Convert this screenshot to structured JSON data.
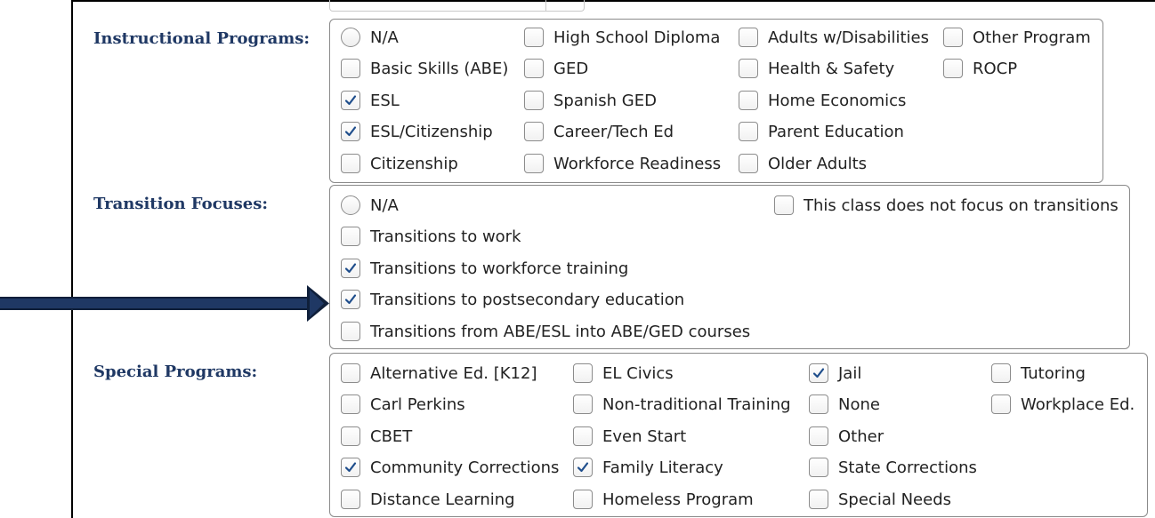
{
  "instructional": {
    "label": "Instructional Programs:",
    "options": [
      {
        "label": "N/A",
        "type": "radio",
        "checked": false
      },
      {
        "label": "High School Diploma",
        "type": "checkbox",
        "checked": false
      },
      {
        "label": "Adults w/Disabilities",
        "type": "checkbox",
        "checked": false
      },
      {
        "label": "Other Program",
        "type": "checkbox",
        "checked": false
      },
      {
        "label": "Basic Skills (ABE)",
        "type": "checkbox",
        "checked": false
      },
      {
        "label": "GED",
        "type": "checkbox",
        "checked": false
      },
      {
        "label": "Health & Safety",
        "type": "checkbox",
        "checked": false
      },
      {
        "label": "ROCP",
        "type": "checkbox",
        "checked": false
      },
      {
        "label": "ESL",
        "type": "checkbox",
        "checked": true
      },
      {
        "label": "Spanish GED",
        "type": "checkbox",
        "checked": false
      },
      {
        "label": "Home Economics",
        "type": "checkbox",
        "checked": false
      },
      {
        "label": "ESL/Citizenship",
        "type": "checkbox",
        "checked": true
      },
      {
        "label": "Career/Tech Ed",
        "type": "checkbox",
        "checked": false
      },
      {
        "label": "Parent Education",
        "type": "checkbox",
        "checked": false
      },
      {
        "label": "Citizenship",
        "type": "checkbox",
        "checked": false
      },
      {
        "label": "Workforce Readiness",
        "type": "checkbox",
        "checked": false
      },
      {
        "label": "Older Adults",
        "type": "checkbox",
        "checked": false
      }
    ]
  },
  "transition": {
    "label": "Transition Focuses:",
    "options": [
      {
        "label": "N/A",
        "type": "radio",
        "checked": false
      },
      {
        "label": "This class does not focus on transitions",
        "type": "checkbox",
        "checked": false
      },
      {
        "label": "Transitions to work",
        "type": "checkbox",
        "checked": false
      },
      {
        "label": "Transitions to workforce training",
        "type": "checkbox",
        "checked": true
      },
      {
        "label": "Transitions to postsecondary education",
        "type": "checkbox",
        "checked": true
      },
      {
        "label": "Transitions from ABE/ESL into ABE/GED courses",
        "type": "checkbox",
        "checked": false
      }
    ]
  },
  "special": {
    "label": "Special Programs:",
    "options": [
      {
        "label": "Alternative Ed. [K12]",
        "type": "checkbox",
        "checked": false
      },
      {
        "label": "EL Civics",
        "type": "checkbox",
        "checked": false
      },
      {
        "label": "Jail",
        "type": "checkbox",
        "checked": true
      },
      {
        "label": "Tutoring",
        "type": "checkbox",
        "checked": false
      },
      {
        "label": "Carl Perkins",
        "type": "checkbox",
        "checked": false
      },
      {
        "label": "Non-traditional Training",
        "type": "checkbox",
        "checked": false
      },
      {
        "label": "None",
        "type": "checkbox",
        "checked": false
      },
      {
        "label": "Workplace Ed.",
        "type": "checkbox",
        "checked": false
      },
      {
        "label": "CBET",
        "type": "checkbox",
        "checked": false
      },
      {
        "label": "Even Start",
        "type": "checkbox",
        "checked": false
      },
      {
        "label": "Other",
        "type": "checkbox",
        "checked": false
      },
      {
        "label": "Community Corrections",
        "type": "checkbox",
        "checked": true
      },
      {
        "label": "Family Literacy",
        "type": "checkbox",
        "checked": true
      },
      {
        "label": "State Corrections",
        "type": "checkbox",
        "checked": false
      },
      {
        "label": "Distance Learning",
        "type": "checkbox",
        "checked": false
      },
      {
        "label": "Homeless Program",
        "type": "checkbox",
        "checked": false
      },
      {
        "label": "Special Needs",
        "type": "checkbox",
        "checked": false
      }
    ]
  },
  "colors": {
    "label_text": "#1f3864",
    "checkmark": "#1f4e8c",
    "arrow": "#1f3864"
  },
  "icons": {
    "checkmark": "check-icon",
    "arrow": "arrow-right-icon"
  }
}
